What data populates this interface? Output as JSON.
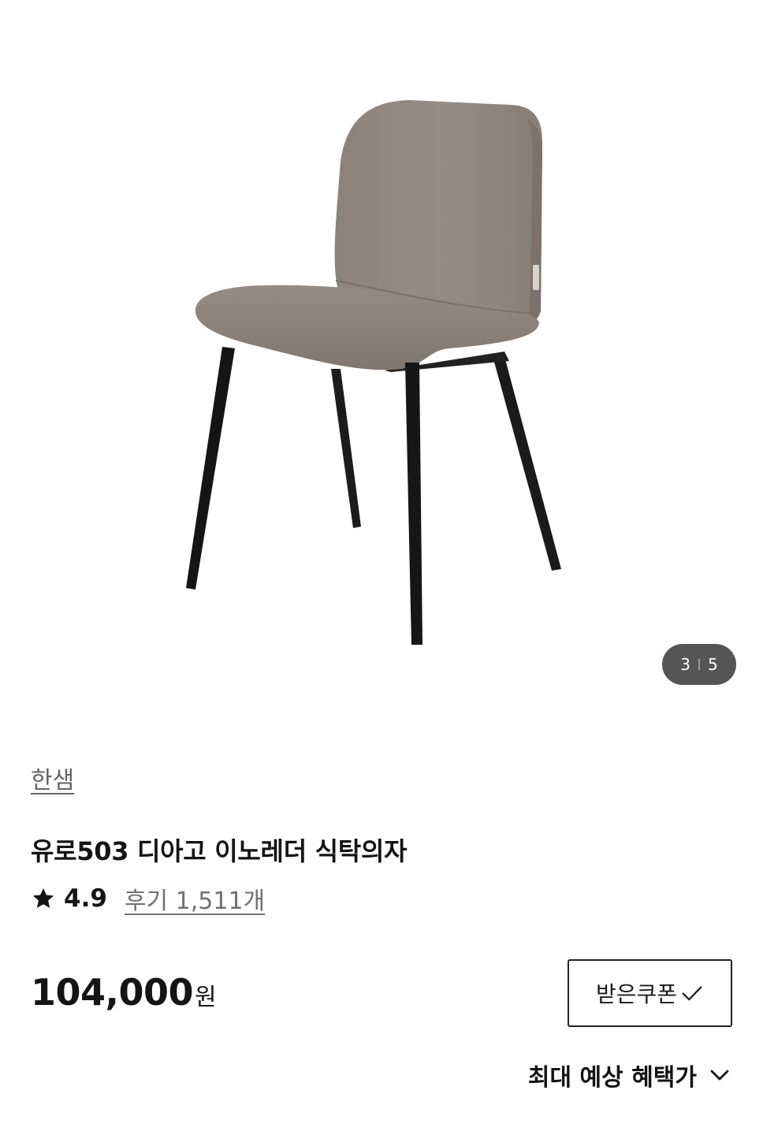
{
  "gallery": {
    "image_alt": "chair-photo",
    "current_index": "3",
    "total_count": "5"
  },
  "product": {
    "brand": "한샘",
    "title": "유로503 디아고 이노레더 식탁의자",
    "rating": "4.9",
    "review_link": "후기 1,511개",
    "price_amount": "104,000",
    "price_unit": "원"
  },
  "coupon": {
    "label": "받은쿠폰"
  },
  "benefit": {
    "label": "최대 예상 혜택가"
  },
  "colors": {
    "text_primary": "#141414",
    "text_secondary": "#666666",
    "counter_bg": "#555555",
    "chair_shell": "#8f867f",
    "chair_legs": "#1b1b1b"
  },
  "icons": {
    "rating": "star-icon",
    "coupon": "check-icon",
    "benefit": "chevron-down-icon"
  }
}
